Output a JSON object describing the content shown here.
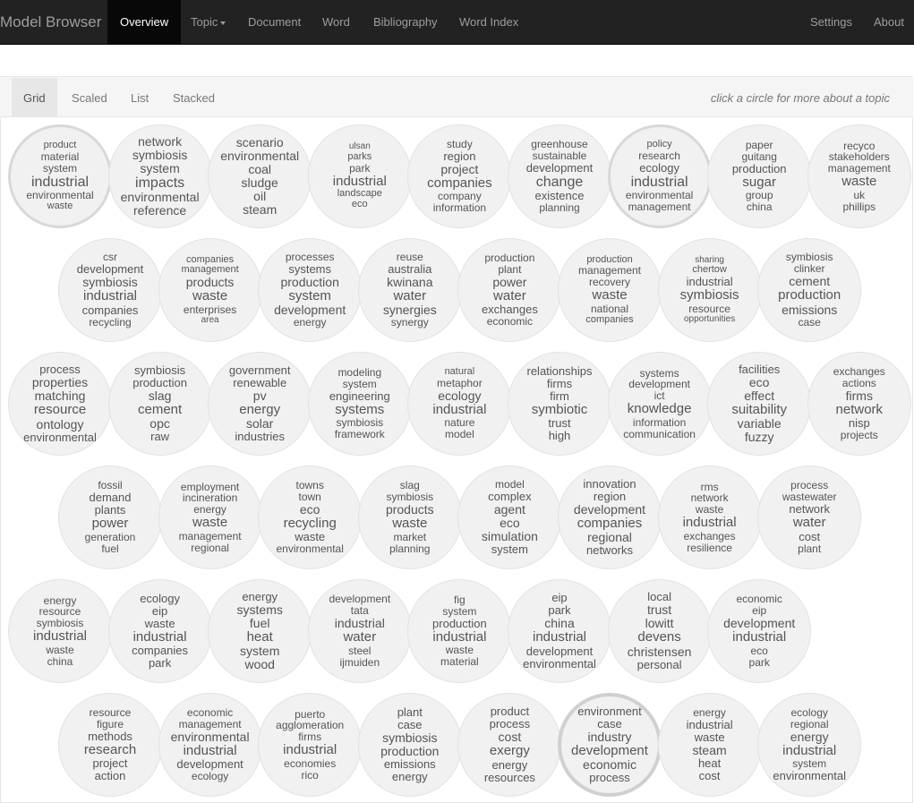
{
  "navbar": {
    "brand": "Model Browser",
    "items": [
      {
        "label": "Overview"
      },
      {
        "label": "Topic"
      },
      {
        "label": "Document"
      },
      {
        "label": "Word"
      },
      {
        "label": "Bibliography"
      },
      {
        "label": "Word Index"
      },
      {
        "label": "Settings"
      },
      {
        "label": "About"
      }
    ]
  },
  "tabs": {
    "items": [
      {
        "label": "Grid"
      },
      {
        "label": "Scaled"
      },
      {
        "label": "List"
      },
      {
        "label": "Stacked"
      }
    ],
    "hint": "click a circle for more about a topic"
  },
  "topics": [
    {
      "words": [
        "product",
        "material",
        "system",
        "industrial",
        "environmental",
        "waste"
      ],
      "weights": [
        0.35,
        0.45,
        0.5,
        1,
        0.55,
        0.4
      ]
    },
    {
      "words": [
        "network",
        "symbiosis",
        "system",
        "impacts",
        "environmental",
        "reference"
      ],
      "weights": [
        0.7,
        0.75,
        0.8,
        1,
        0.8,
        0.7
      ]
    },
    {
      "words": [
        "scenario",
        "environmental",
        "coal",
        "sludge",
        "oil",
        "steam"
      ],
      "weights": [
        0.75,
        0.75,
        0.75,
        0.8,
        0.7,
        0.7
      ]
    },
    {
      "words": [
        "ulsan",
        "parks",
        "park",
        "industrial",
        "landscape",
        "eco"
      ],
      "weights": [
        0.3,
        0.4,
        0.5,
        0.9,
        0.4,
        0.35
      ]
    },
    {
      "words": [
        "study",
        "region",
        "project",
        "companies",
        "company",
        "information"
      ],
      "weights": [
        0.5,
        0.6,
        0.8,
        0.9,
        0.55,
        0.45
      ]
    },
    {
      "words": [
        "greenhouse",
        "sustainable",
        "development",
        "change",
        "existence",
        "planning"
      ],
      "weights": [
        0.5,
        0.55,
        0.6,
        1,
        0.6,
        0.5
      ]
    },
    {
      "words": [
        "policy",
        "research",
        "ecology",
        "industrial",
        "environmental",
        "management"
      ],
      "weights": [
        0.4,
        0.45,
        0.6,
        1,
        0.5,
        0.45
      ]
    },
    {
      "words": [
        "paper",
        "guitang",
        "production",
        "sugar",
        "group",
        "china"
      ],
      "weights": [
        0.5,
        0.5,
        0.6,
        0.9,
        0.55,
        0.45
      ]
    },
    {
      "words": [
        "recyco",
        "stakeholders",
        "management",
        "waste",
        "uk",
        "phillips"
      ],
      "weights": [
        0.45,
        0.5,
        0.5,
        0.9,
        0.5,
        0.5
      ]
    },
    {
      "words": [
        "csr",
        "development",
        "symbiosis",
        "industrial",
        "companies",
        "recycling"
      ],
      "weights": [
        0.55,
        0.6,
        0.8,
        0.9,
        0.6,
        0.55
      ]
    },
    {
      "words": [
        "companies",
        "management",
        "products",
        "waste",
        "enterprises",
        "area"
      ],
      "weights": [
        0.35,
        0.4,
        0.75,
        0.9,
        0.55,
        0.3
      ]
    },
    {
      "words": [
        "processes",
        "systems",
        "production",
        "system",
        "development",
        "energy"
      ],
      "weights": [
        0.55,
        0.6,
        0.8,
        0.9,
        0.75,
        0.55
      ]
    },
    {
      "words": [
        "reuse",
        "australia",
        "kwinana",
        "water",
        "synergies",
        "synergy"
      ],
      "weights": [
        0.55,
        0.6,
        0.7,
        0.9,
        0.75,
        0.55
      ]
    },
    {
      "words": [
        "production",
        "plant",
        "power",
        "water",
        "exchanges",
        "economic"
      ],
      "weights": [
        0.5,
        0.55,
        0.7,
        0.9,
        0.6,
        0.5
      ]
    },
    {
      "words": [
        "production",
        "management",
        "recovery",
        "waste",
        "national",
        "companies"
      ],
      "weights": [
        0.4,
        0.45,
        0.45,
        0.9,
        0.45,
        0.35
      ]
    },
    {
      "words": [
        "sharing",
        "chertow",
        "industrial",
        "symbiosis",
        "resource",
        "opportunities"
      ],
      "weights": [
        0.3,
        0.35,
        0.6,
        0.9,
        0.45,
        0.3
      ]
    },
    {
      "words": [
        "symbiosis",
        "clinker",
        "cement",
        "production",
        "emissions",
        "case"
      ],
      "weights": [
        0.5,
        0.5,
        0.75,
        0.9,
        0.75,
        0.5
      ]
    },
    {
      "words": [
        "process",
        "properties",
        "matching",
        "resource",
        "ontology",
        "environmental"
      ],
      "weights": [
        0.6,
        0.7,
        0.8,
        0.9,
        0.75,
        0.6
      ]
    },
    {
      "words": [
        "symbiosis",
        "production",
        "slag",
        "cement",
        "opc",
        "raw"
      ],
      "weights": [
        0.6,
        0.6,
        0.8,
        0.9,
        0.7,
        0.6
      ]
    },
    {
      "words": [
        "government",
        "renewable",
        "pv",
        "energy",
        "solar",
        "industries"
      ],
      "weights": [
        0.6,
        0.6,
        0.75,
        0.9,
        0.75,
        0.6
      ]
    },
    {
      "words": [
        "modeling",
        "system",
        "engineering",
        "systems",
        "symbiosis",
        "framework"
      ],
      "weights": [
        0.5,
        0.5,
        0.6,
        0.9,
        0.5,
        0.5
      ]
    },
    {
      "words": [
        "natural",
        "metaphor",
        "ecology",
        "industrial",
        "nature",
        "model"
      ],
      "weights": [
        0.4,
        0.5,
        0.75,
        0.9,
        0.55,
        0.5
      ]
    },
    {
      "words": [
        "relationships",
        "firms",
        "firm",
        "symbiotic",
        "trust",
        "high"
      ],
      "weights": [
        0.6,
        0.6,
        0.6,
        0.9,
        0.65,
        0.6
      ]
    },
    {
      "words": [
        "systems",
        "development",
        "ict",
        "knowledge",
        "information",
        "communication"
      ],
      "weights": [
        0.5,
        0.5,
        0.55,
        0.9,
        0.5,
        0.45
      ]
    },
    {
      "words": [
        "facilities",
        "eco",
        "effect",
        "suitability",
        "variable",
        "fuzzy"
      ],
      "weights": [
        0.65,
        0.7,
        0.75,
        0.9,
        0.75,
        0.75
      ]
    },
    {
      "words": [
        "exchanges",
        "actions",
        "firms",
        "network",
        "nisp",
        "projects"
      ],
      "weights": [
        0.55,
        0.55,
        0.7,
        0.9,
        0.6,
        0.55
      ]
    },
    {
      "words": [
        "fossil",
        "demand",
        "plants",
        "power",
        "generation",
        "fuel"
      ],
      "weights": [
        0.55,
        0.6,
        0.6,
        0.9,
        0.55,
        0.55
      ]
    },
    {
      "words": [
        "employment",
        "incineration",
        "energy",
        "waste",
        "management",
        "regional"
      ],
      "weights": [
        0.45,
        0.45,
        0.45,
        0.9,
        0.55,
        0.5
      ]
    },
    {
      "words": [
        "towns",
        "town",
        "eco",
        "recycling",
        "waste",
        "environmental"
      ],
      "weights": [
        0.5,
        0.55,
        0.75,
        0.9,
        0.6,
        0.55
      ]
    },
    {
      "words": [
        "slag",
        "symbiosis",
        "products",
        "waste",
        "market",
        "planning"
      ],
      "weights": [
        0.5,
        0.5,
        0.7,
        0.9,
        0.5,
        0.5
      ]
    },
    {
      "words": [
        "model",
        "complex",
        "agent",
        "eco",
        "simulation",
        "system"
      ],
      "weights": [
        0.55,
        0.6,
        0.7,
        0.75,
        0.7,
        0.65
      ]
    },
    {
      "words": [
        "innovation",
        "region",
        "development",
        "companies",
        "regional",
        "networks"
      ],
      "weights": [
        0.6,
        0.6,
        0.75,
        0.85,
        0.75,
        0.65
      ]
    },
    {
      "words": [
        "rms",
        "network",
        "waste",
        "industrial",
        "exchanges",
        "resilience"
      ],
      "weights": [
        0.45,
        0.45,
        0.45,
        0.9,
        0.5,
        0.45
      ]
    },
    {
      "words": [
        "process",
        "wastewater",
        "network",
        "water",
        "cost",
        "plant"
      ],
      "weights": [
        0.5,
        0.55,
        0.6,
        0.9,
        0.6,
        0.55
      ]
    },
    {
      "words": [
        "energy",
        "resource",
        "symbiosis",
        "industrial",
        "waste",
        "china"
      ],
      "weights": [
        0.5,
        0.5,
        0.55,
        0.9,
        0.5,
        0.5
      ]
    },
    {
      "words": [
        "ecology",
        "eip",
        "waste",
        "industrial",
        "companies",
        "park"
      ],
      "weights": [
        0.6,
        0.6,
        0.6,
        0.9,
        0.6,
        0.6
      ]
    },
    {
      "words": [
        "energy",
        "systems",
        "fuel",
        "heat",
        "system",
        "wood"
      ],
      "weights": [
        0.65,
        0.7,
        0.75,
        0.9,
        0.75,
        0.7
      ]
    },
    {
      "words": [
        "development",
        "tata",
        "industrial",
        "water",
        "steel",
        "ijmuiden"
      ],
      "weights": [
        0.55,
        0.55,
        0.75,
        0.9,
        0.55,
        0.55
      ]
    },
    {
      "words": [
        "fig",
        "system",
        "production",
        "industrial",
        "waste",
        "material"
      ],
      "weights": [
        0.5,
        0.55,
        0.6,
        0.9,
        0.55,
        0.5
      ]
    },
    {
      "words": [
        "eip",
        "park",
        "china",
        "industrial",
        "development",
        "environmental"
      ],
      "weights": [
        0.6,
        0.6,
        0.75,
        0.9,
        0.65,
        0.6
      ]
    },
    {
      "words": [
        "local",
        "trust",
        "lowitt",
        "devens",
        "christensen",
        "personal"
      ],
      "weights": [
        0.65,
        0.7,
        0.75,
        0.9,
        0.75,
        0.65
      ]
    },
    {
      "words": [
        "economic",
        "eip",
        "development",
        "industrial",
        "eco",
        "park"
      ],
      "weights": [
        0.5,
        0.55,
        0.75,
        0.9,
        0.55,
        0.5
      ]
    },
    {
      "words": [
        "resource",
        "figure",
        "methods",
        "research",
        "project",
        "action"
      ],
      "weights": [
        0.55,
        0.55,
        0.6,
        0.9,
        0.6,
        0.6
      ]
    },
    {
      "words": [
        "economic",
        "management",
        "environmental",
        "industrial",
        "development",
        "ecology"
      ],
      "weights": [
        0.5,
        0.55,
        0.75,
        0.9,
        0.6,
        0.5
      ]
    },
    {
      "words": [
        "puerto",
        "agglomeration",
        "firms",
        "industrial",
        "economies",
        "rico"
      ],
      "weights": [
        0.5,
        0.5,
        0.55,
        0.9,
        0.55,
        0.5
      ]
    },
    {
      "words": [
        "plant",
        "case",
        "symbiosis",
        "production",
        "emissions",
        "energy"
      ],
      "weights": [
        0.6,
        0.6,
        0.7,
        0.8,
        0.6,
        0.6
      ]
    },
    {
      "words": [
        "product",
        "process",
        "cost",
        "exergy",
        "energy",
        "resources"
      ],
      "weights": [
        0.6,
        0.6,
        0.75,
        0.9,
        0.6,
        0.6
      ]
    },
    {
      "words": [
        "environment",
        "case",
        "industry",
        "development",
        "economic",
        "process"
      ],
      "weights": [
        0.65,
        0.65,
        0.7,
        0.9,
        0.7,
        0.65
      ]
    },
    {
      "words": [
        "energy",
        "industrial",
        "waste",
        "steam",
        "heat",
        "cost"
      ],
      "weights": [
        0.5,
        0.6,
        0.6,
        0.8,
        0.6,
        0.6
      ]
    },
    {
      "words": [
        "ecology",
        "regional",
        "energy",
        "industrial",
        "system",
        "environmental"
      ],
      "weights": [
        0.5,
        0.55,
        0.75,
        0.9,
        0.55,
        0.6
      ]
    }
  ]
}
